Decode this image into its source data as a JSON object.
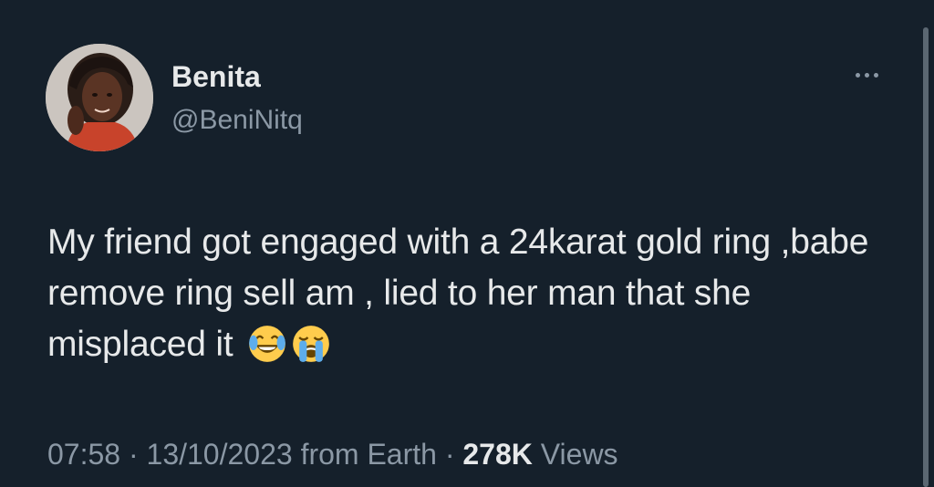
{
  "author": {
    "display_name": "Benita",
    "handle": "@BeniNitq",
    "avatar_icon": "profile-photo"
  },
  "more_icon": "more-horizontal-icon",
  "tweet": {
    "text": "My friend got engaged with a 24karat gold ring ,babe remove ring sell am , lied to her man that she misplaced it",
    "emojis": [
      "face-with-tears-of-joy",
      "loudly-crying-face"
    ]
  },
  "meta": {
    "time": "07:58",
    "date": "13/10/2023",
    "source": "from Earth",
    "separator": "·",
    "views_count": "278K",
    "views_label": "Views"
  },
  "colors": {
    "background": "#15202b",
    "text_primary": "#e7e9ea",
    "text_secondary": "#8b98a5"
  }
}
